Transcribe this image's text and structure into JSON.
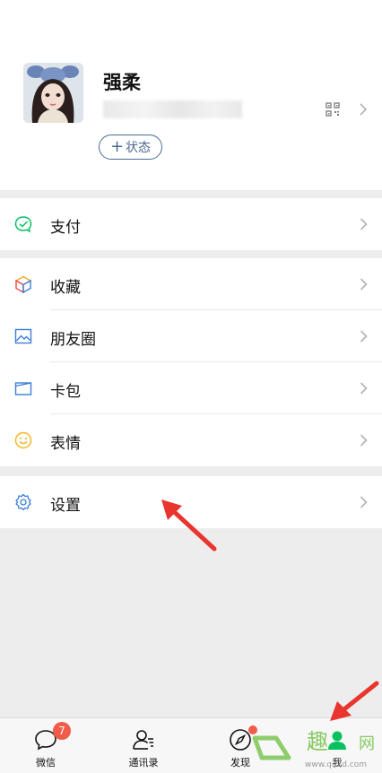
{
  "profile": {
    "name": "强柔",
    "status_button": "状态",
    "status_plus": "+"
  },
  "menu": {
    "pay": "支付",
    "favorites": "收藏",
    "moments": "朋友圈",
    "cards": "卡包",
    "stickers": "表情",
    "settings": "设置"
  },
  "tabbar": {
    "chats": "微信",
    "chats_badge": "7",
    "contacts": "通讯录",
    "discover": "发现",
    "me": "我"
  },
  "watermark": {
    "text": "趣",
    "text2": "网",
    "url": "www.qu2d.com"
  },
  "colors": {
    "accent_link": "#4d6a92",
    "wechat_green": "#07c160",
    "badge_red": "#f15b4a",
    "annotation_red": "#e8352e"
  },
  "icons": {
    "pay": "wallet-check-icon",
    "favorites": "cube-icon",
    "moments": "picture-icon",
    "cards": "card-icon",
    "stickers": "smiley-icon",
    "settings": "gear-icon"
  }
}
